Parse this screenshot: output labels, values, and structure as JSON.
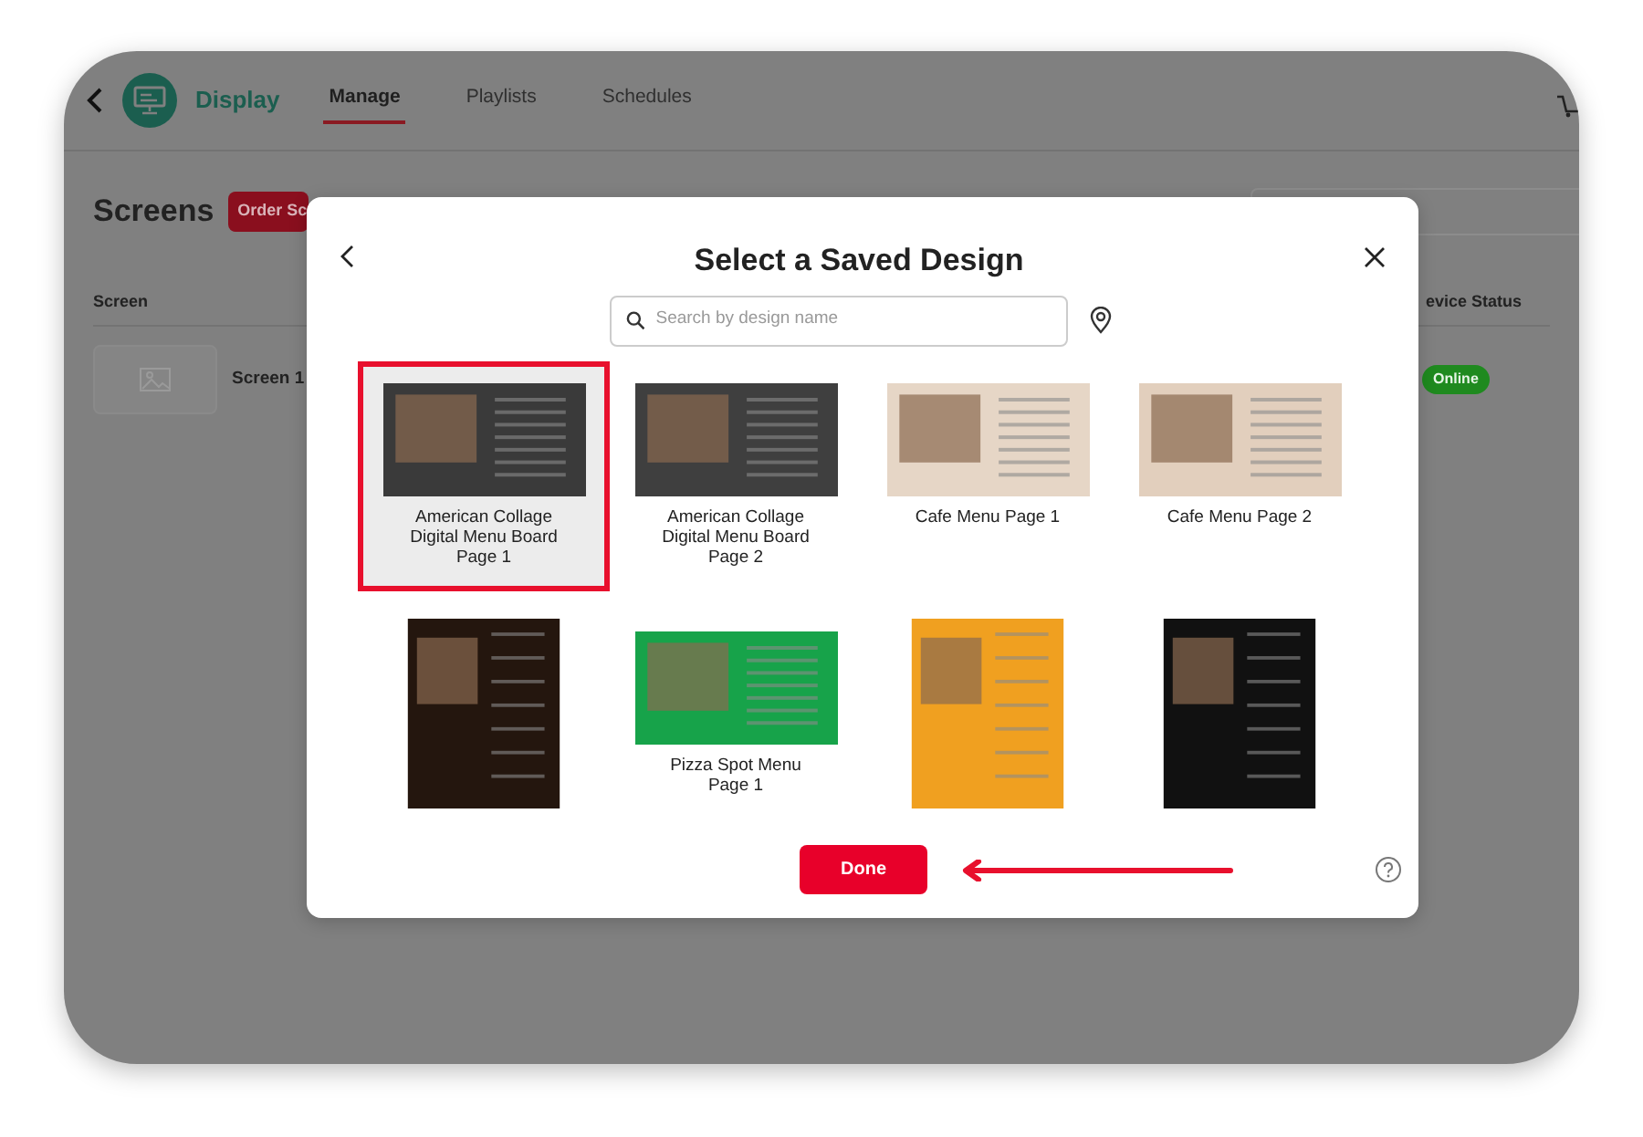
{
  "app": {
    "brand": "Display",
    "tabs": [
      {
        "label": "Manage",
        "selected": true
      },
      {
        "label": "Playlists",
        "selected": false
      },
      {
        "label": "Schedules",
        "selected": false
      }
    ],
    "page_title": "Screens",
    "order_button": "Order Sc",
    "table": {
      "columns": [
        "Screen",
        "evice Status"
      ],
      "rows": [
        {
          "name": "Screen 1",
          "status": "Online"
        }
      ]
    }
  },
  "dialog": {
    "title": "Select a Saved Design",
    "search": {
      "placeholder": "Search by design name"
    },
    "designs": [
      {
        "name": "American Collage Digital Menu Board Page 1",
        "kind": "landscape",
        "color": "#3a3a3a",
        "selected": true
      },
      {
        "name": "American Collage Digital Menu Board Page 2",
        "kind": "landscape",
        "color": "#3f3f3f",
        "selected": false
      },
      {
        "name": "Cafe Menu Page 1",
        "kind": "landscape",
        "color": "#e6d6c6",
        "selected": false
      },
      {
        "name": "Cafe Menu Page 2",
        "kind": "landscape",
        "color": "#e2cfbd",
        "selected": false
      },
      {
        "kind": "portrait",
        "color": "#24160e",
        "selected": false
      },
      {
        "name": "Pizza Spot Menu Page 1",
        "kind": "landscape",
        "color": "#17a34a",
        "selected": false
      },
      {
        "kind": "portrait",
        "color": "#f0a020",
        "selected": false
      },
      {
        "kind": "portrait",
        "color": "#111111",
        "selected": false
      }
    ],
    "done_button": "Done"
  }
}
